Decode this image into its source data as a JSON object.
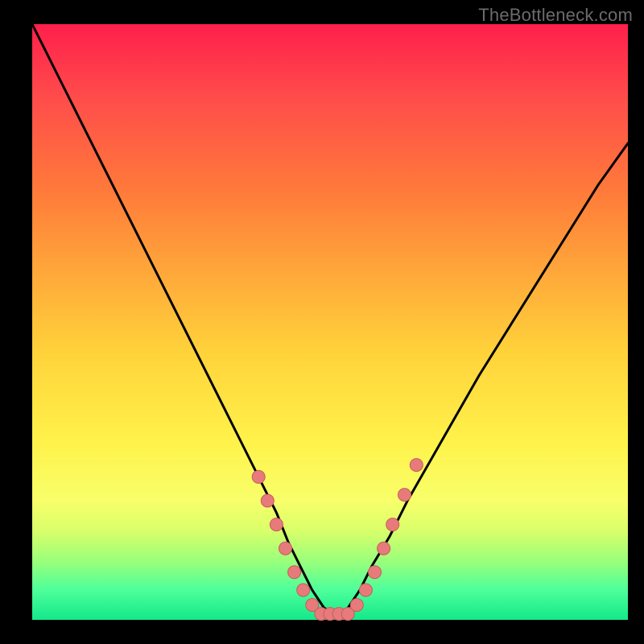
{
  "watermark": "TheBottleneck.com",
  "colors": {
    "background": "#000000",
    "gradient_top": "#ff1f4b",
    "gradient_bottom": "#14e88a",
    "curve": "#000000",
    "marker_fill": "#e77b7b",
    "marker_stroke": "#c95a5a"
  },
  "chart_data": {
    "type": "line",
    "title": "",
    "xlabel": "",
    "ylabel": "",
    "xlim": [
      0,
      100
    ],
    "ylim": [
      0,
      100
    ],
    "grid": false,
    "legend": false,
    "series": [
      {
        "name": "bottleneck-curve",
        "x": [
          0,
          2,
          5,
          8,
          11,
          14,
          17,
          20,
          23,
          26,
          29,
          32,
          35,
          38,
          41,
          43,
          45,
          47,
          49,
          51,
          53,
          55,
          57,
          60,
          63,
          67,
          71,
          75,
          80,
          85,
          90,
          95,
          100
        ],
        "y": [
          100,
          96,
          90,
          84,
          78,
          72,
          66,
          60,
          54,
          48,
          42,
          36,
          30,
          24,
          18,
          13,
          9,
          5,
          2,
          1,
          2,
          5,
          9,
          14,
          20,
          27,
          34,
          41,
          49,
          57,
          65,
          73,
          80
        ]
      }
    ],
    "markers": [
      {
        "x": 38,
        "y": 24
      },
      {
        "x": 39.5,
        "y": 20
      },
      {
        "x": 41,
        "y": 16
      },
      {
        "x": 42.5,
        "y": 12
      },
      {
        "x": 44,
        "y": 8
      },
      {
        "x": 45.5,
        "y": 5
      },
      {
        "x": 47,
        "y": 2.5
      },
      {
        "x": 48.5,
        "y": 1
      },
      {
        "x": 50,
        "y": 1
      },
      {
        "x": 51.5,
        "y": 1
      },
      {
        "x": 53,
        "y": 1
      },
      {
        "x": 54.5,
        "y": 2.5
      },
      {
        "x": 56,
        "y": 5
      },
      {
        "x": 57.5,
        "y": 8
      },
      {
        "x": 59,
        "y": 12
      },
      {
        "x": 60.5,
        "y": 16
      },
      {
        "x": 62.5,
        "y": 21
      },
      {
        "x": 64.5,
        "y": 26
      }
    ]
  }
}
